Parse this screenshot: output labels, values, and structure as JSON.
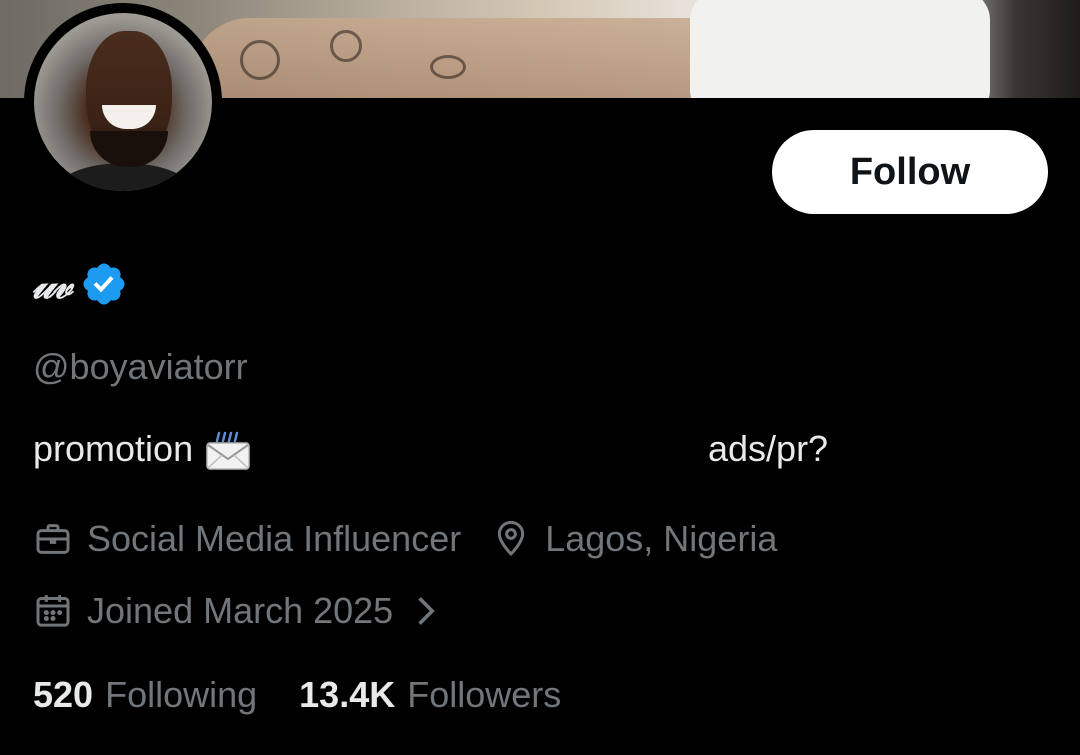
{
  "profile": {
    "display_name": "𝓊𝓋",
    "handle": "@boyaviatorr",
    "bio_text": "promotion",
    "bio_extra": "ads/pr?",
    "occupation": "Social Media Influencer",
    "location": "Lagos, Nigeria",
    "joined": "Joined March 2025",
    "verified": true
  },
  "actions": {
    "follow_label": "Follow"
  },
  "stats": {
    "following_count": "520",
    "following_label": "Following",
    "followers_count": "13.4K",
    "followers_label": "Followers"
  },
  "icons": {
    "verified": "verified-badge-icon",
    "envelope": "incoming-envelope-icon",
    "occupation": "briefcase-icon",
    "location": "location-pin-icon",
    "joined": "calendar-icon",
    "joined_more": "chevron-right-icon"
  },
  "colors": {
    "background": "#000000",
    "primary_text": "#e7e9ea",
    "secondary_text": "#71767b",
    "verified_blue": "#1d9bf0",
    "button_bg": "#ffffff",
    "button_text": "#0f1419"
  }
}
